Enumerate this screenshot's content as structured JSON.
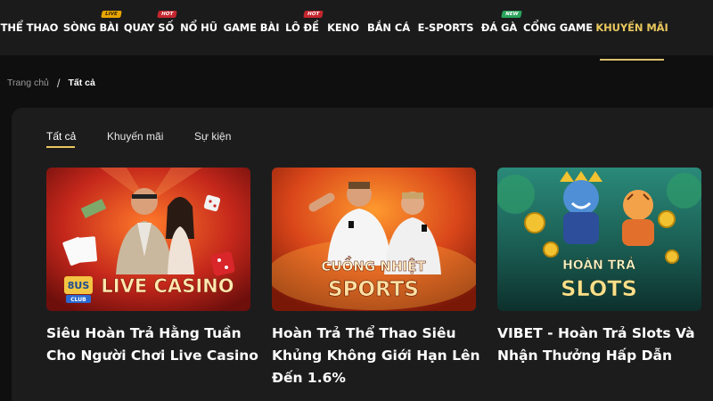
{
  "nav": {
    "items": [
      {
        "label": "THỂ THAO"
      },
      {
        "label": "SÒNG BÀI",
        "badge": "LIVE"
      },
      {
        "label": "QUAY SỐ",
        "badge": "HOT"
      },
      {
        "label": "NỔ HŨ"
      },
      {
        "label": "GAME BÀI"
      },
      {
        "label": "LÔ ĐỀ",
        "badge": "HOT"
      },
      {
        "label": "KENO"
      },
      {
        "label": "BẮN CÁ"
      },
      {
        "label": "E-SPORTS"
      },
      {
        "label": "ĐÁ GÀ",
        "badge": "NEW"
      },
      {
        "label": "CỔNG GAME"
      },
      {
        "label": "KHUYẾN MÃI",
        "active": true
      }
    ]
  },
  "breadcrumb": {
    "home": "Trang chủ",
    "separator": "/",
    "current": "Tất cả"
  },
  "tabs": [
    {
      "label": "Tất cả",
      "active": true
    },
    {
      "label": "Khuyến mãi"
    },
    {
      "label": "Sự kiện"
    }
  ],
  "cards": [
    {
      "title": "Siêu Hoàn Trả Hằng Tuần Cho Người Chơi Live Casino",
      "banner": {
        "logo": "8US",
        "logo_sub": "CLUB",
        "line1": "LIVE CASINO",
        "line2": ""
      }
    },
    {
      "title": "Hoàn Trả Thể Thao Siêu Khủng Không Giới Hạn Lên Đến 1.6%",
      "banner": {
        "line1": "CUỒNG NHIỆT",
        "line2": "SPORTS"
      }
    },
    {
      "title": "VIBET - Hoàn Trả Slots Và Nhận Thưởng Hấp Dẫn",
      "banner": {
        "line1": "HOÀN TRẢ",
        "line2": "SLOTS"
      }
    }
  ],
  "colors": {
    "accent": "#e9c75d",
    "nav_bg": "#1b1b1c",
    "page_bg": "#0f0f10",
    "panel_bg": "#1c1c1d"
  }
}
